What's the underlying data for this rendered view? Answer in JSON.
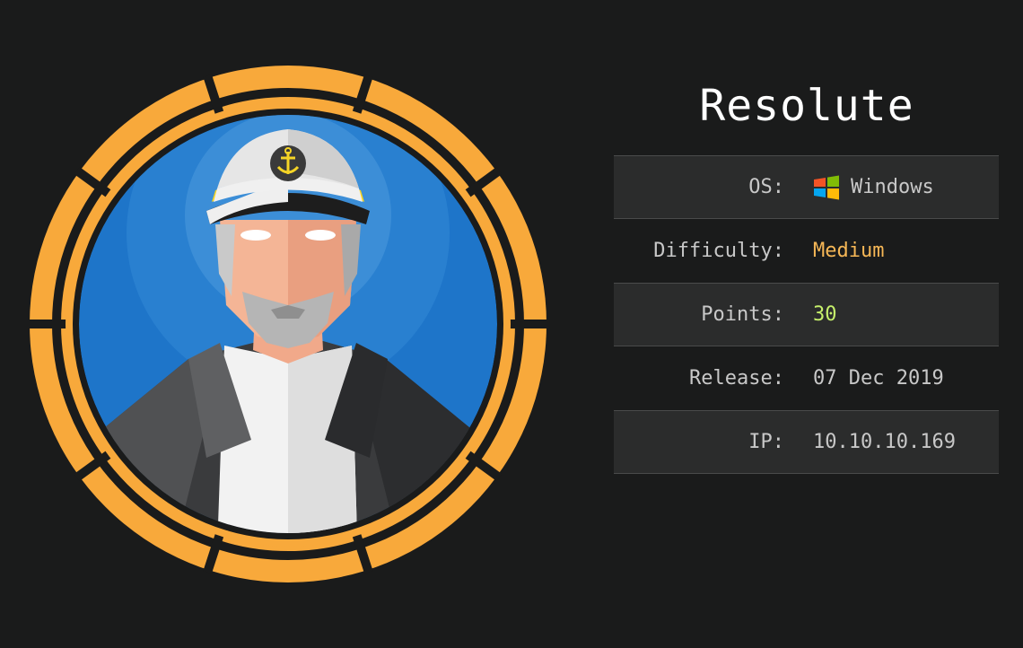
{
  "machine": {
    "name": "Resolute"
  },
  "info": {
    "os_label": "OS:",
    "os_value": "Windows",
    "os_icon": "windows-logo-icon",
    "difficulty_label": "Difficulty:",
    "difficulty_value": "Medium",
    "difficulty_color": "#f6b756",
    "points_label": "Points:",
    "points_value": "30",
    "points_color": "#c6f06b",
    "release_label": "Release:",
    "release_value": "07 Dec 2019",
    "ip_label": "IP:",
    "ip_value": "10.10.10.169"
  },
  "colors": {
    "background": "#1a1b1b",
    "ring": "#f8a93b",
    "avatar_bg": "#1e75c9",
    "row_shade": "#2b2c2c"
  }
}
